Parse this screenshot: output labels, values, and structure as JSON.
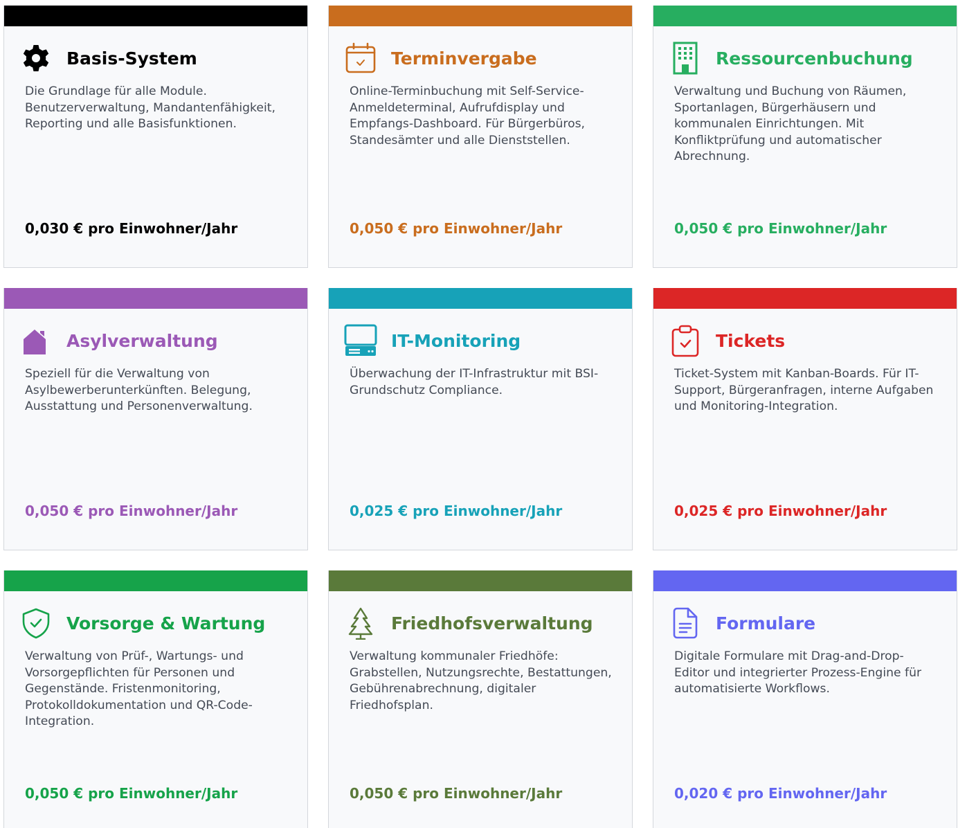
{
  "modules": [
    {
      "title": "Basis-System",
      "icon": "gear-icon",
      "color": "#000000",
      "description": "Die Grundlage für alle Module. Benutzerverwaltung, Mandantenfähigkeit, Reporting und alle Basisfunktionen.",
      "price": "0,030 € pro Einwohner/Jahr"
    },
    {
      "title": "Terminvergabe",
      "icon": "calendar-icon",
      "color": "#c96d1e",
      "description": "Online-Terminbuchung mit Self-Service-Anmeldeterminal, Aufrufdisplay und Empfangs-Dashboard. Für Bürgerbüros, Standesämter und alle Dienststellen.",
      "price": "0,050 € pro Einwohner/Jahr"
    },
    {
      "title": "Ressourcenbuchung",
      "icon": "building-icon",
      "color": "#27ae60",
      "description": "Verwaltung und Buchung von Räumen, Sportanlagen, Bürgerhäusern und kommunalen Einrichtungen. Mit Konfliktprüfung und automatischer Abrechnung.",
      "price": "0,050 € pro Einwohner/Jahr"
    },
    {
      "title": "Asylverwaltung",
      "icon": "house-icon",
      "color": "#9b59b6",
      "description": "Speziell für die Verwaltung von Asylbewerberunterkünften. Belegung, Ausstattung und Personenverwaltung.",
      "price": "0,050 € pro Einwohner/Jahr"
    },
    {
      "title": "IT-Monitoring",
      "icon": "computer-icon",
      "color": "#17a2b8",
      "description": "Überwachung der IT-Infrastruktur mit BSI-Grundschutz Compliance.",
      "price": "0,025 € pro Einwohner/Jahr"
    },
    {
      "title": "Tickets",
      "icon": "clipboard-check-icon",
      "color": "#dc2626",
      "description": "Ticket-System mit Kanban-Boards. Für IT-Support, Bürgeranfragen, interne Aufgaben und Monitoring-Integration.",
      "price": "0,025 € pro Einwohner/Jahr"
    },
    {
      "title": "Vorsorge & Wartung",
      "icon": "shield-check-icon",
      "color": "#16a34a",
      "description": "Verwaltung von Prüf-, Wartungs- und Vorsorgepflichten für Personen und Gegenstände. Fristenmonitoring, Protokolldokumentation und QR-Code-Integration.",
      "price": "0,050 € pro Einwohner/Jahr"
    },
    {
      "title": "Friedhofsverwaltung",
      "icon": "tree-icon",
      "color": "#5a7a3a",
      "description": "Verwaltung kommunaler Friedhöfe: Grabstellen, Nutzungsrechte, Bestattungen, Gebührenabrechnung, digitaler Friedhofsplan.",
      "price": "0,050 € pro Einwohner/Jahr"
    },
    {
      "title": "Formulare",
      "icon": "document-icon",
      "color": "#6366f1",
      "description": "Digitale Formulare mit Drag-and-Drop-Editor und integrierter Prozess-Engine für automatisierte Workflows.",
      "price": "0,020 € pro Einwohner/Jahr"
    }
  ]
}
